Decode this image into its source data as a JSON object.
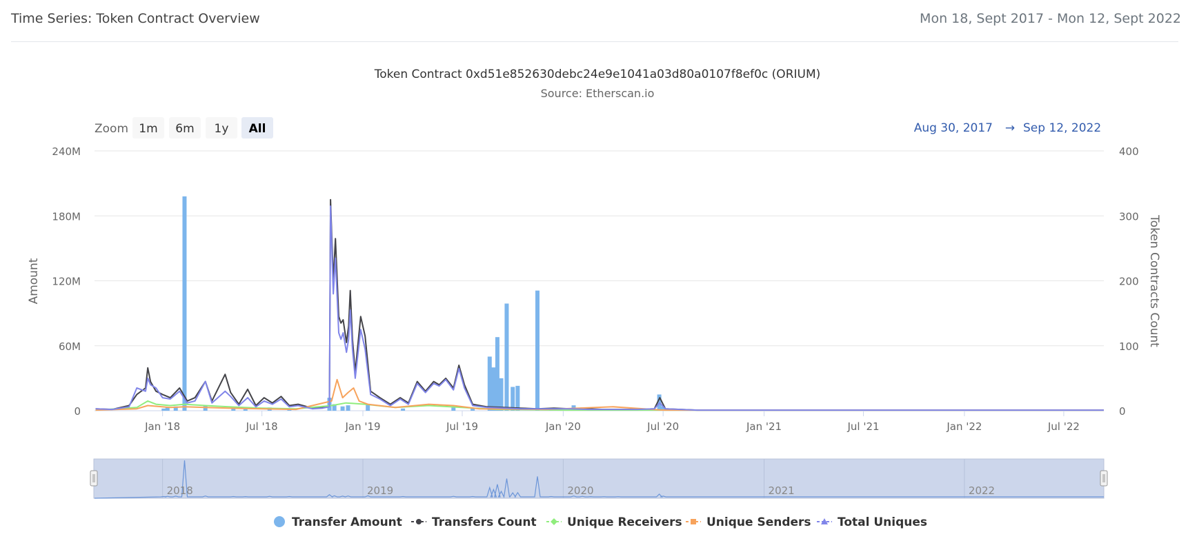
{
  "header": {
    "title": "Time Series: Token Contract Overview",
    "date_range": "Mon 18, Sept 2017 - Mon 12, Sept 2022"
  },
  "chart_header": {
    "title": "Token Contract 0xd51e852630debc24e9e1041a03d80a0107f8ef0c (ORIUM)",
    "subtitle": "Source: Etherscan.io"
  },
  "range_selector": {
    "zoom_label": "Zoom",
    "buttons": [
      "1m",
      "6m",
      "1y",
      "All"
    ],
    "selected": "All",
    "from": "Aug 30, 2017",
    "arrow": "→",
    "to": "Sep 12, 2022"
  },
  "colors": {
    "transfer_amount": "#7cb5ec",
    "transfers_count": "#434348",
    "unique_receivers": "#90ed7d",
    "unique_senders": "#f7a35c",
    "total_uniques": "#8085e9",
    "navigator_fill": "#c9d3ea",
    "navigator_line": "#6b95d8"
  },
  "chart_data": {
    "type": "bar",
    "x_axis": {
      "type": "datetime",
      "range": [
        "2017-08-30",
        "2022-09-12"
      ],
      "ticks": [
        {
          "date": "2018-01-01",
          "label": "Jan '18"
        },
        {
          "date": "2018-07-01",
          "label": "Jul '18"
        },
        {
          "date": "2019-01-01",
          "label": "Jan '19"
        },
        {
          "date": "2019-07-01",
          "label": "Jul '19"
        },
        {
          "date": "2020-01-01",
          "label": "Jan '20"
        },
        {
          "date": "2020-07-01",
          "label": "Jul '20"
        },
        {
          "date": "2021-01-01",
          "label": "Jan '21"
        },
        {
          "date": "2021-07-01",
          "label": "Jul '21"
        },
        {
          "date": "2022-01-01",
          "label": "Jan '22"
        },
        {
          "date": "2022-07-01",
          "label": "Jul '22"
        }
      ]
    },
    "y_left": {
      "label": "Amount",
      "range": [
        0,
        240000000
      ],
      "ticks": [
        {
          "value": 0,
          "label": "0"
        },
        {
          "value": 60000000,
          "label": "60M"
        },
        {
          "value": 120000000,
          "label": "120M"
        },
        {
          "value": 180000000,
          "label": "180M"
        },
        {
          "value": 240000000,
          "label": "240M"
        }
      ]
    },
    "y_right": {
      "label": "Token Contracts Count",
      "range": [
        0,
        400
      ],
      "ticks": [
        {
          "value": 0,
          "label": "0"
        },
        {
          "value": 100,
          "label": "100"
        },
        {
          "value": 200,
          "label": "200"
        },
        {
          "value": 300,
          "label": "300"
        },
        {
          "value": 400,
          "label": "400"
        }
      ]
    },
    "grid": true,
    "legend_position": "bottom",
    "series": [
      {
        "name": "Transfer Amount",
        "type": "column",
        "axis": "left",
        "points": [
          [
            "2018-01-03",
            2000000
          ],
          [
            "2018-01-10",
            3000000
          ],
          [
            "2018-01-25",
            4000000
          ],
          [
            "2018-02-10",
            198000000
          ],
          [
            "2018-03-20",
            5000000
          ],
          [
            "2018-05-10",
            2000000
          ],
          [
            "2018-06-01",
            1500000
          ],
          [
            "2018-07-15",
            3000000
          ],
          [
            "2018-08-20",
            2000000
          ],
          [
            "2018-11-01",
            12000000
          ],
          [
            "2018-11-10",
            6000000
          ],
          [
            "2018-11-25",
            4000000
          ],
          [
            "2018-12-05",
            5000000
          ],
          [
            "2019-01-10",
            6000000
          ],
          [
            "2019-03-15",
            2000000
          ],
          [
            "2019-06-15",
            3000000
          ],
          [
            "2019-07-20",
            2000000
          ],
          [
            "2019-08-20",
            50000000
          ],
          [
            "2019-08-27",
            40000000
          ],
          [
            "2019-09-03",
            68000000
          ],
          [
            "2019-09-10",
            30000000
          ],
          [
            "2019-09-20",
            99000000
          ],
          [
            "2019-10-01",
            22000000
          ],
          [
            "2019-10-10",
            23000000
          ],
          [
            "2019-11-15",
            111000000
          ],
          [
            "2019-12-10",
            2000000
          ],
          [
            "2020-01-20",
            5000000
          ],
          [
            "2020-02-05",
            3000000
          ],
          [
            "2020-02-20",
            1500000
          ],
          [
            "2020-03-15",
            1000000
          ],
          [
            "2020-04-10",
            1000000
          ],
          [
            "2020-06-24",
            15000000
          ],
          [
            "2020-07-01",
            4000000
          ]
        ]
      },
      {
        "name": "Transfers Count",
        "type": "line",
        "axis": "right",
        "points": [
          [
            "2017-09-01",
            3
          ],
          [
            "2017-10-01",
            2
          ],
          [
            "2017-11-01",
            8
          ],
          [
            "2017-11-15",
            25
          ],
          [
            "2017-12-01",
            35
          ],
          [
            "2017-12-05",
            66
          ],
          [
            "2017-12-10",
            45
          ],
          [
            "2017-12-20",
            30
          ],
          [
            "2018-01-01",
            25
          ],
          [
            "2018-01-15",
            20
          ],
          [
            "2018-02-01",
            35
          ],
          [
            "2018-02-15",
            15
          ],
          [
            "2018-03-01",
            20
          ],
          [
            "2018-03-20",
            45
          ],
          [
            "2018-04-01",
            15
          ],
          [
            "2018-04-25",
            56
          ],
          [
            "2018-05-05",
            28
          ],
          [
            "2018-05-20",
            10
          ],
          [
            "2018-06-05",
            33
          ],
          [
            "2018-06-20",
            8
          ],
          [
            "2018-07-05",
            20
          ],
          [
            "2018-07-20",
            12
          ],
          [
            "2018-08-05",
            22
          ],
          [
            "2018-08-20",
            8
          ],
          [
            "2018-09-05",
            10
          ],
          [
            "2018-10-01",
            4
          ],
          [
            "2018-10-20",
            5
          ],
          [
            "2018-11-01",
            8
          ],
          [
            "2018-11-03",
            325
          ],
          [
            "2018-11-08",
            200
          ],
          [
            "2018-11-12",
            265
          ],
          [
            "2018-11-18",
            145
          ],
          [
            "2018-11-22",
            135
          ],
          [
            "2018-11-26",
            140
          ],
          [
            "2018-12-02",
            105
          ],
          [
            "2018-12-06",
            130
          ],
          [
            "2018-12-09",
            185
          ],
          [
            "2018-12-13",
            110
          ],
          [
            "2018-12-18",
            60
          ],
          [
            "2018-12-28",
            145
          ],
          [
            "2019-01-05",
            115
          ],
          [
            "2019-01-15",
            30
          ],
          [
            "2019-02-01",
            20
          ],
          [
            "2019-02-20",
            10
          ],
          [
            "2019-03-10",
            20
          ],
          [
            "2019-03-25",
            12
          ],
          [
            "2019-04-10",
            45
          ],
          [
            "2019-04-25",
            30
          ],
          [
            "2019-05-10",
            45
          ],
          [
            "2019-05-20",
            40
          ],
          [
            "2019-06-01",
            50
          ],
          [
            "2019-06-15",
            35
          ],
          [
            "2019-06-25",
            70
          ],
          [
            "2019-07-05",
            40
          ],
          [
            "2019-07-20",
            10
          ],
          [
            "2019-08-15",
            6
          ],
          [
            "2019-09-15",
            5
          ],
          [
            "2019-10-15",
            4
          ],
          [
            "2019-11-15",
            3
          ],
          [
            "2019-12-15",
            4
          ],
          [
            "2020-01-15",
            3
          ],
          [
            "2020-02-15",
            3
          ],
          [
            "2020-03-15",
            2
          ],
          [
            "2020-04-15",
            2
          ],
          [
            "2020-05-15",
            2
          ],
          [
            "2020-06-15",
            3
          ],
          [
            "2020-06-25",
            20
          ],
          [
            "2020-07-05",
            3
          ],
          [
            "2020-09-01",
            1
          ],
          [
            "2021-01-01",
            1
          ],
          [
            "2021-07-01",
            1
          ],
          [
            "2022-01-01",
            1
          ],
          [
            "2022-09-12",
            1
          ]
        ]
      },
      {
        "name": "Unique Receivers",
        "type": "line",
        "axis": "right",
        "points": [
          [
            "2017-09-01",
            1
          ],
          [
            "2017-11-15",
            5
          ],
          [
            "2017-12-05",
            15
          ],
          [
            "2017-12-20",
            10
          ],
          [
            "2018-01-15",
            8
          ],
          [
            "2018-02-10",
            10
          ],
          [
            "2018-03-20",
            8
          ],
          [
            "2018-05-01",
            6
          ],
          [
            "2018-07-01",
            4
          ],
          [
            "2018-09-01",
            3
          ],
          [
            "2018-11-05",
            8
          ],
          [
            "2018-12-01",
            12
          ],
          [
            "2019-01-05",
            10
          ],
          [
            "2019-03-01",
            5
          ],
          [
            "2019-05-01",
            8
          ],
          [
            "2019-07-01",
            5
          ],
          [
            "2019-09-01",
            2
          ],
          [
            "2020-01-01",
            1
          ],
          [
            "2020-07-01",
            1
          ],
          [
            "2022-09-12",
            1
          ]
        ]
      },
      {
        "name": "Unique Senders",
        "type": "line",
        "axis": "right",
        "points": [
          [
            "2017-09-01",
            1
          ],
          [
            "2017-11-15",
            3
          ],
          [
            "2017-12-05",
            8
          ],
          [
            "2018-01-15",
            5
          ],
          [
            "2018-02-10",
            6
          ],
          [
            "2018-03-20",
            5
          ],
          [
            "2018-05-01",
            4
          ],
          [
            "2018-07-01",
            3
          ],
          [
            "2018-09-01",
            2
          ],
          [
            "2018-11-05",
            15
          ],
          [
            "2018-11-15",
            48
          ],
          [
            "2018-11-25",
            20
          ],
          [
            "2018-12-05",
            28
          ],
          [
            "2018-12-15",
            35
          ],
          [
            "2018-12-25",
            15
          ],
          [
            "2019-01-10",
            10
          ],
          [
            "2019-03-01",
            5
          ],
          [
            "2019-05-01",
            10
          ],
          [
            "2019-06-15",
            8
          ],
          [
            "2019-08-01",
            3
          ],
          [
            "2019-12-01",
            2
          ],
          [
            "2020-04-01",
            6
          ],
          [
            "2020-07-01",
            1
          ],
          [
            "2022-09-12",
            1
          ]
        ]
      },
      {
        "name": "Total Uniques",
        "type": "line",
        "axis": "right",
        "points": [
          [
            "2017-09-01",
            3
          ],
          [
            "2017-10-01",
            2
          ],
          [
            "2017-11-01",
            6
          ],
          [
            "2017-11-15",
            35
          ],
          [
            "2017-12-01",
            30
          ],
          [
            "2017-12-05",
            50
          ],
          [
            "2017-12-10",
            40
          ],
          [
            "2017-12-20",
            35
          ],
          [
            "2018-01-01",
            20
          ],
          [
            "2018-01-15",
            18
          ],
          [
            "2018-02-01",
            30
          ],
          [
            "2018-02-15",
            12
          ],
          [
            "2018-03-01",
            15
          ],
          [
            "2018-03-20",
            45
          ],
          [
            "2018-04-01",
            12
          ],
          [
            "2018-04-25",
            30
          ],
          [
            "2018-05-05",
            22
          ],
          [
            "2018-05-20",
            8
          ],
          [
            "2018-06-05",
            20
          ],
          [
            "2018-06-20",
            6
          ],
          [
            "2018-07-05",
            15
          ],
          [
            "2018-07-20",
            10
          ],
          [
            "2018-08-05",
            18
          ],
          [
            "2018-08-20",
            6
          ],
          [
            "2018-09-05",
            8
          ],
          [
            "2018-10-01",
            3
          ],
          [
            "2018-10-20",
            4
          ],
          [
            "2018-11-01",
            6
          ],
          [
            "2018-11-03",
            315
          ],
          [
            "2018-11-08",
            180
          ],
          [
            "2018-11-12",
            235
          ],
          [
            "2018-11-18",
            120
          ],
          [
            "2018-11-22",
            110
          ],
          [
            "2018-11-26",
            120
          ],
          [
            "2018-12-02",
            90
          ],
          [
            "2018-12-06",
            110
          ],
          [
            "2018-12-09",
            155
          ],
          [
            "2018-12-13",
            95
          ],
          [
            "2018-12-18",
            50
          ],
          [
            "2018-12-28",
            125
          ],
          [
            "2019-01-05",
            95
          ],
          [
            "2019-01-15",
            25
          ],
          [
            "2019-02-01",
            18
          ],
          [
            "2019-02-20",
            8
          ],
          [
            "2019-03-10",
            18
          ],
          [
            "2019-03-25",
            10
          ],
          [
            "2019-04-10",
            42
          ],
          [
            "2019-04-25",
            28
          ],
          [
            "2019-05-10",
            42
          ],
          [
            "2019-05-20",
            38
          ],
          [
            "2019-06-01",
            48
          ],
          [
            "2019-06-15",
            32
          ],
          [
            "2019-06-25",
            65
          ],
          [
            "2019-07-05",
            35
          ],
          [
            "2019-07-20",
            8
          ],
          [
            "2019-08-15",
            5
          ],
          [
            "2019-09-15",
            4
          ],
          [
            "2019-10-15",
            3
          ],
          [
            "2019-11-15",
            3
          ],
          [
            "2019-12-15",
            3
          ],
          [
            "2020-01-15",
            3
          ],
          [
            "2020-02-15",
            2
          ],
          [
            "2020-03-15",
            2
          ],
          [
            "2020-04-15",
            2
          ],
          [
            "2020-05-15",
            2
          ],
          [
            "2020-06-15",
            3
          ],
          [
            "2020-06-25",
            12
          ],
          [
            "2020-07-05",
            3
          ],
          [
            "2020-09-01",
            1
          ],
          [
            "2021-01-01",
            1
          ],
          [
            "2021-07-01",
            1
          ],
          [
            "2022-01-01",
            1
          ],
          [
            "2022-09-12",
            1
          ]
        ]
      }
    ],
    "navigator": {
      "labels": [
        "2018",
        "2019",
        "2020",
        "2021",
        "2022"
      ],
      "label_dates": [
        "2018-01-01",
        "2019-01-01",
        "2020-01-01",
        "2021-01-01",
        "2022-01-01"
      ]
    }
  },
  "legend": [
    {
      "name": "Transfer Amount",
      "marker": "circle",
      "color_key": "transfer_amount"
    },
    {
      "name": "Transfers Count",
      "marker": "line-circle",
      "color_key": "transfers_count"
    },
    {
      "name": "Unique Receivers",
      "marker": "line-diamond",
      "color_key": "unique_receivers"
    },
    {
      "name": "Unique Senders",
      "marker": "line-square",
      "color_key": "unique_senders"
    },
    {
      "name": "Total Uniques",
      "marker": "line-triangle",
      "color_key": "total_uniques"
    }
  ]
}
